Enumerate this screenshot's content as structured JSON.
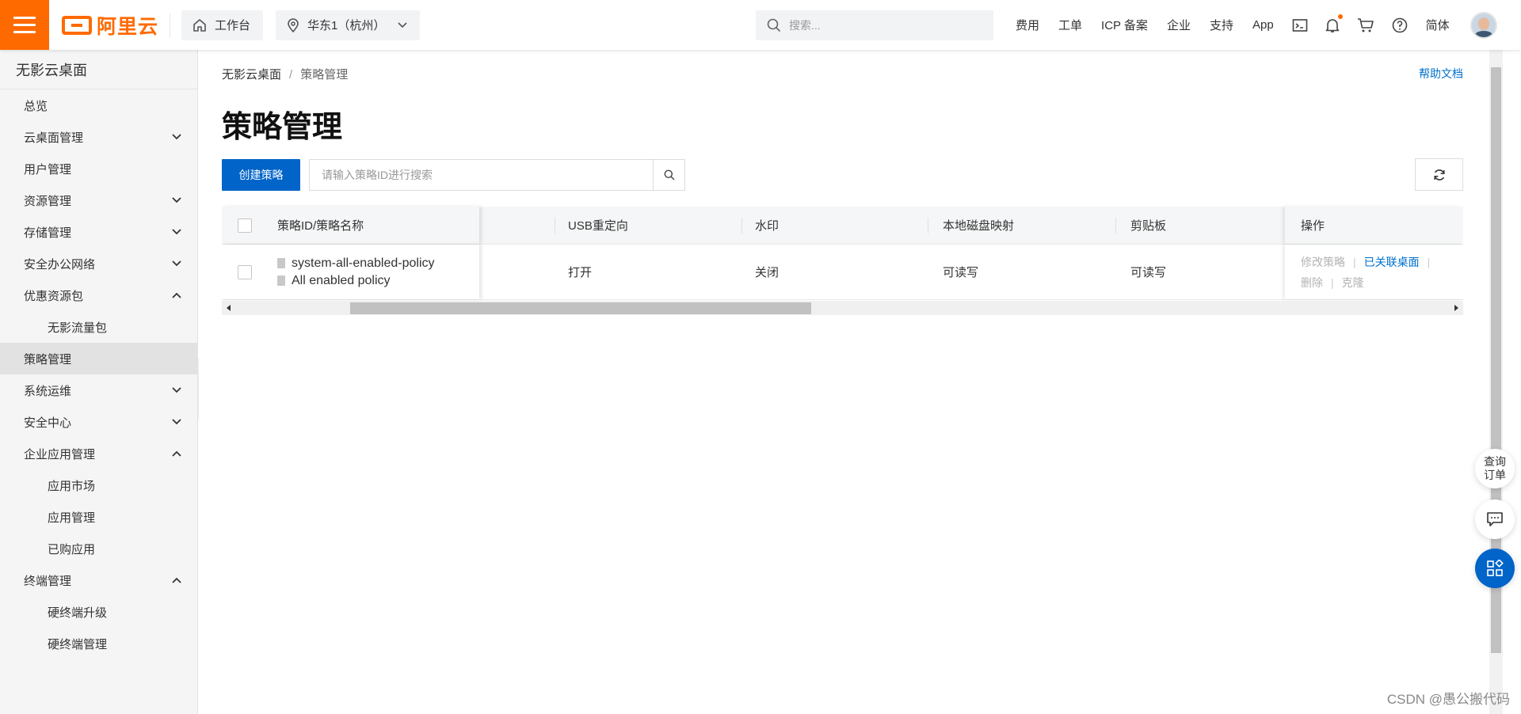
{
  "topbar": {
    "logo_text": "阿里云",
    "workbench_label": "工作台",
    "region_label": "华东1（杭州）",
    "search_placeholder": "搜索...",
    "nav": [
      "费用",
      "工单",
      "ICP 备案",
      "企业",
      "支持",
      "App"
    ],
    "language": "简体"
  },
  "sidebar": {
    "title": "无影云桌面",
    "items": [
      {
        "label": "总览",
        "chevron": ""
      },
      {
        "label": "云桌面管理",
        "chevron": "down"
      },
      {
        "label": "用户管理",
        "chevron": ""
      },
      {
        "label": "资源管理",
        "chevron": "down"
      },
      {
        "label": "存储管理",
        "chevron": "down"
      },
      {
        "label": "安全办公网络",
        "chevron": "down"
      },
      {
        "label": "优惠资源包",
        "chevron": "up"
      },
      {
        "label": "无影流量包",
        "chevron": "",
        "sub": true
      },
      {
        "label": "策略管理",
        "chevron": "",
        "active": true
      },
      {
        "label": "系统运维",
        "chevron": "down"
      },
      {
        "label": "安全中心",
        "chevron": "down"
      },
      {
        "label": "企业应用管理",
        "chevron": "up"
      },
      {
        "label": "应用市场",
        "chevron": "",
        "sub": true
      },
      {
        "label": "应用管理",
        "chevron": "",
        "sub": true
      },
      {
        "label": "已购应用",
        "chevron": "",
        "sub": true
      },
      {
        "label": "终端管理",
        "chevron": "up"
      },
      {
        "label": "硬终端升级",
        "chevron": "",
        "sub": true
      },
      {
        "label": "硬终端管理",
        "chevron": "",
        "sub": true
      }
    ]
  },
  "main": {
    "breadcrumb": [
      "无影云桌面",
      "策略管理"
    ],
    "help_link": "帮助文档",
    "page_title": "策略管理",
    "create_button": "创建策略",
    "search_placeholder": "请输入策略ID进行搜索",
    "table": {
      "headers": {
        "policy": "策略ID/策略名称",
        "usb": "USB重定向",
        "watermark": "水印",
        "disk": "本地磁盘映射",
        "clipboard": "剪贴板",
        "actions": "操作"
      },
      "rows": [
        {
          "policy_id": "system-all-enabled-policy",
          "policy_name": "All enabled policy",
          "usb": "打开",
          "watermark": "关闭",
          "disk": "可读写",
          "clipboard": "可读写",
          "actions": {
            "modify": "修改策略",
            "linked": "已关联桌面",
            "delete": "删除",
            "clone": "克隆"
          }
        }
      ]
    }
  },
  "floating": {
    "query_line1": "查询",
    "query_line2": "订单"
  },
  "watermark_text": "CSDN @愚公搬代码",
  "colors": {
    "brand": "#ff6a00",
    "primary": "#0064c8",
    "link": "#0070cc"
  }
}
